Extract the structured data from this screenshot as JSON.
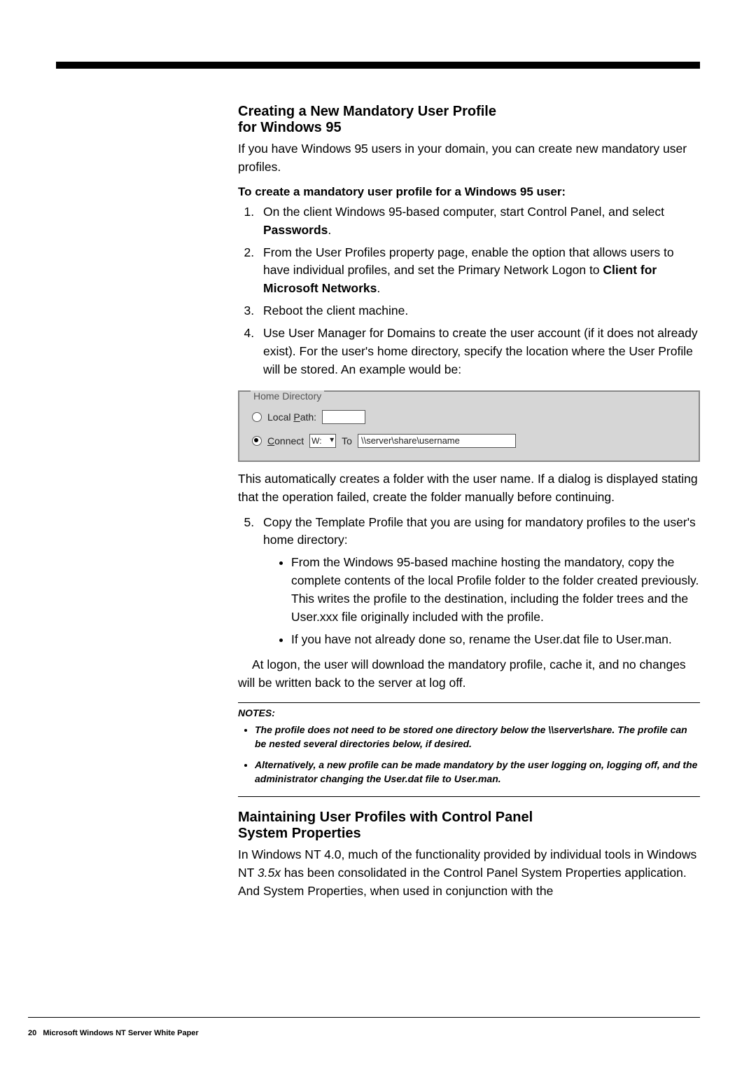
{
  "heading1_line1": "Creating a New Mandatory User Profile",
  "heading1_line2": "for Windows 95",
  "intro": "If you have Windows 95 users in your domain, you can create new mandatory user profiles.",
  "procTitle": "To create a mandatory user profile for a Windows 95 user:",
  "step1_a": "On the client Windows 95-based computer, start Control Panel, and select ",
  "step1_b": "Passwords",
  "step1_c": ".",
  "step2_a": "From the User Profiles property page, enable the option that allows users to have individual profiles, and set the Primary Network Logon to ",
  "step2_b": "Client for Microsoft Networks",
  "step2_c": ".",
  "step3": "Reboot the client machine.",
  "step4": "Use User Manager for Domains to create the user account (if it does not already exist). For the user's home directory, specify the location where the User Profile will be stored. An example would be:",
  "dialog": {
    "legend": "Home Directory",
    "localPath_label_pre": "Local ",
    "localPath_label_u": "P",
    "localPath_label_post": "ath:",
    "connect_u": "C",
    "connect_post": "onnect",
    "drive": "W:",
    "to_label": "To",
    "path": "\\\\server\\share\\username"
  },
  "afterDialog": "This automatically creates a folder with the user name. If a dialog is displayed stating that the operation failed, create the folder manually before continuing.",
  "step5_a": "Copy the Template Profile that you are using for mandatory profiles to the user's home directory:",
  "step5_sub1": "From the Windows 95-based machine hosting the mandatory, copy the complete contents of the local Profile folder to the folder created previously. This writes the profile to the destination, including the folder trees and the User.xxx file originally included with the profile.",
  "step5_sub2": "If you have not already done so, rename the User.dat file to User.man.",
  "closing": "At logon, the user will download the mandatory profile, cache it, and no changes will be written back to the server at log off.",
  "notesLabel": "NOTES:",
  "note1": "The profile does not need to be stored one directory below the \\\\server\\share. The profile can be nested several directories below, if desired.",
  "note2": "Alternatively, a new profile can be made mandatory by the user logging on, logging off, and the administrator changing the User.dat file to User.man.",
  "heading2_line1": "Maintaining User Profiles with Control Panel",
  "heading2_line2": "System Properties",
  "para2_a": "In Windows NT 4.0, much of the functionality provided by individual tools in Windows NT ",
  "para2_b": "3.5x",
  "para2_c": " has been consolidated in the Control Panel System Properties application. And System Properties, when used in conjunction with the",
  "footer_page": "20",
  "footer_text": "Microsoft Windows NT Server White Paper"
}
